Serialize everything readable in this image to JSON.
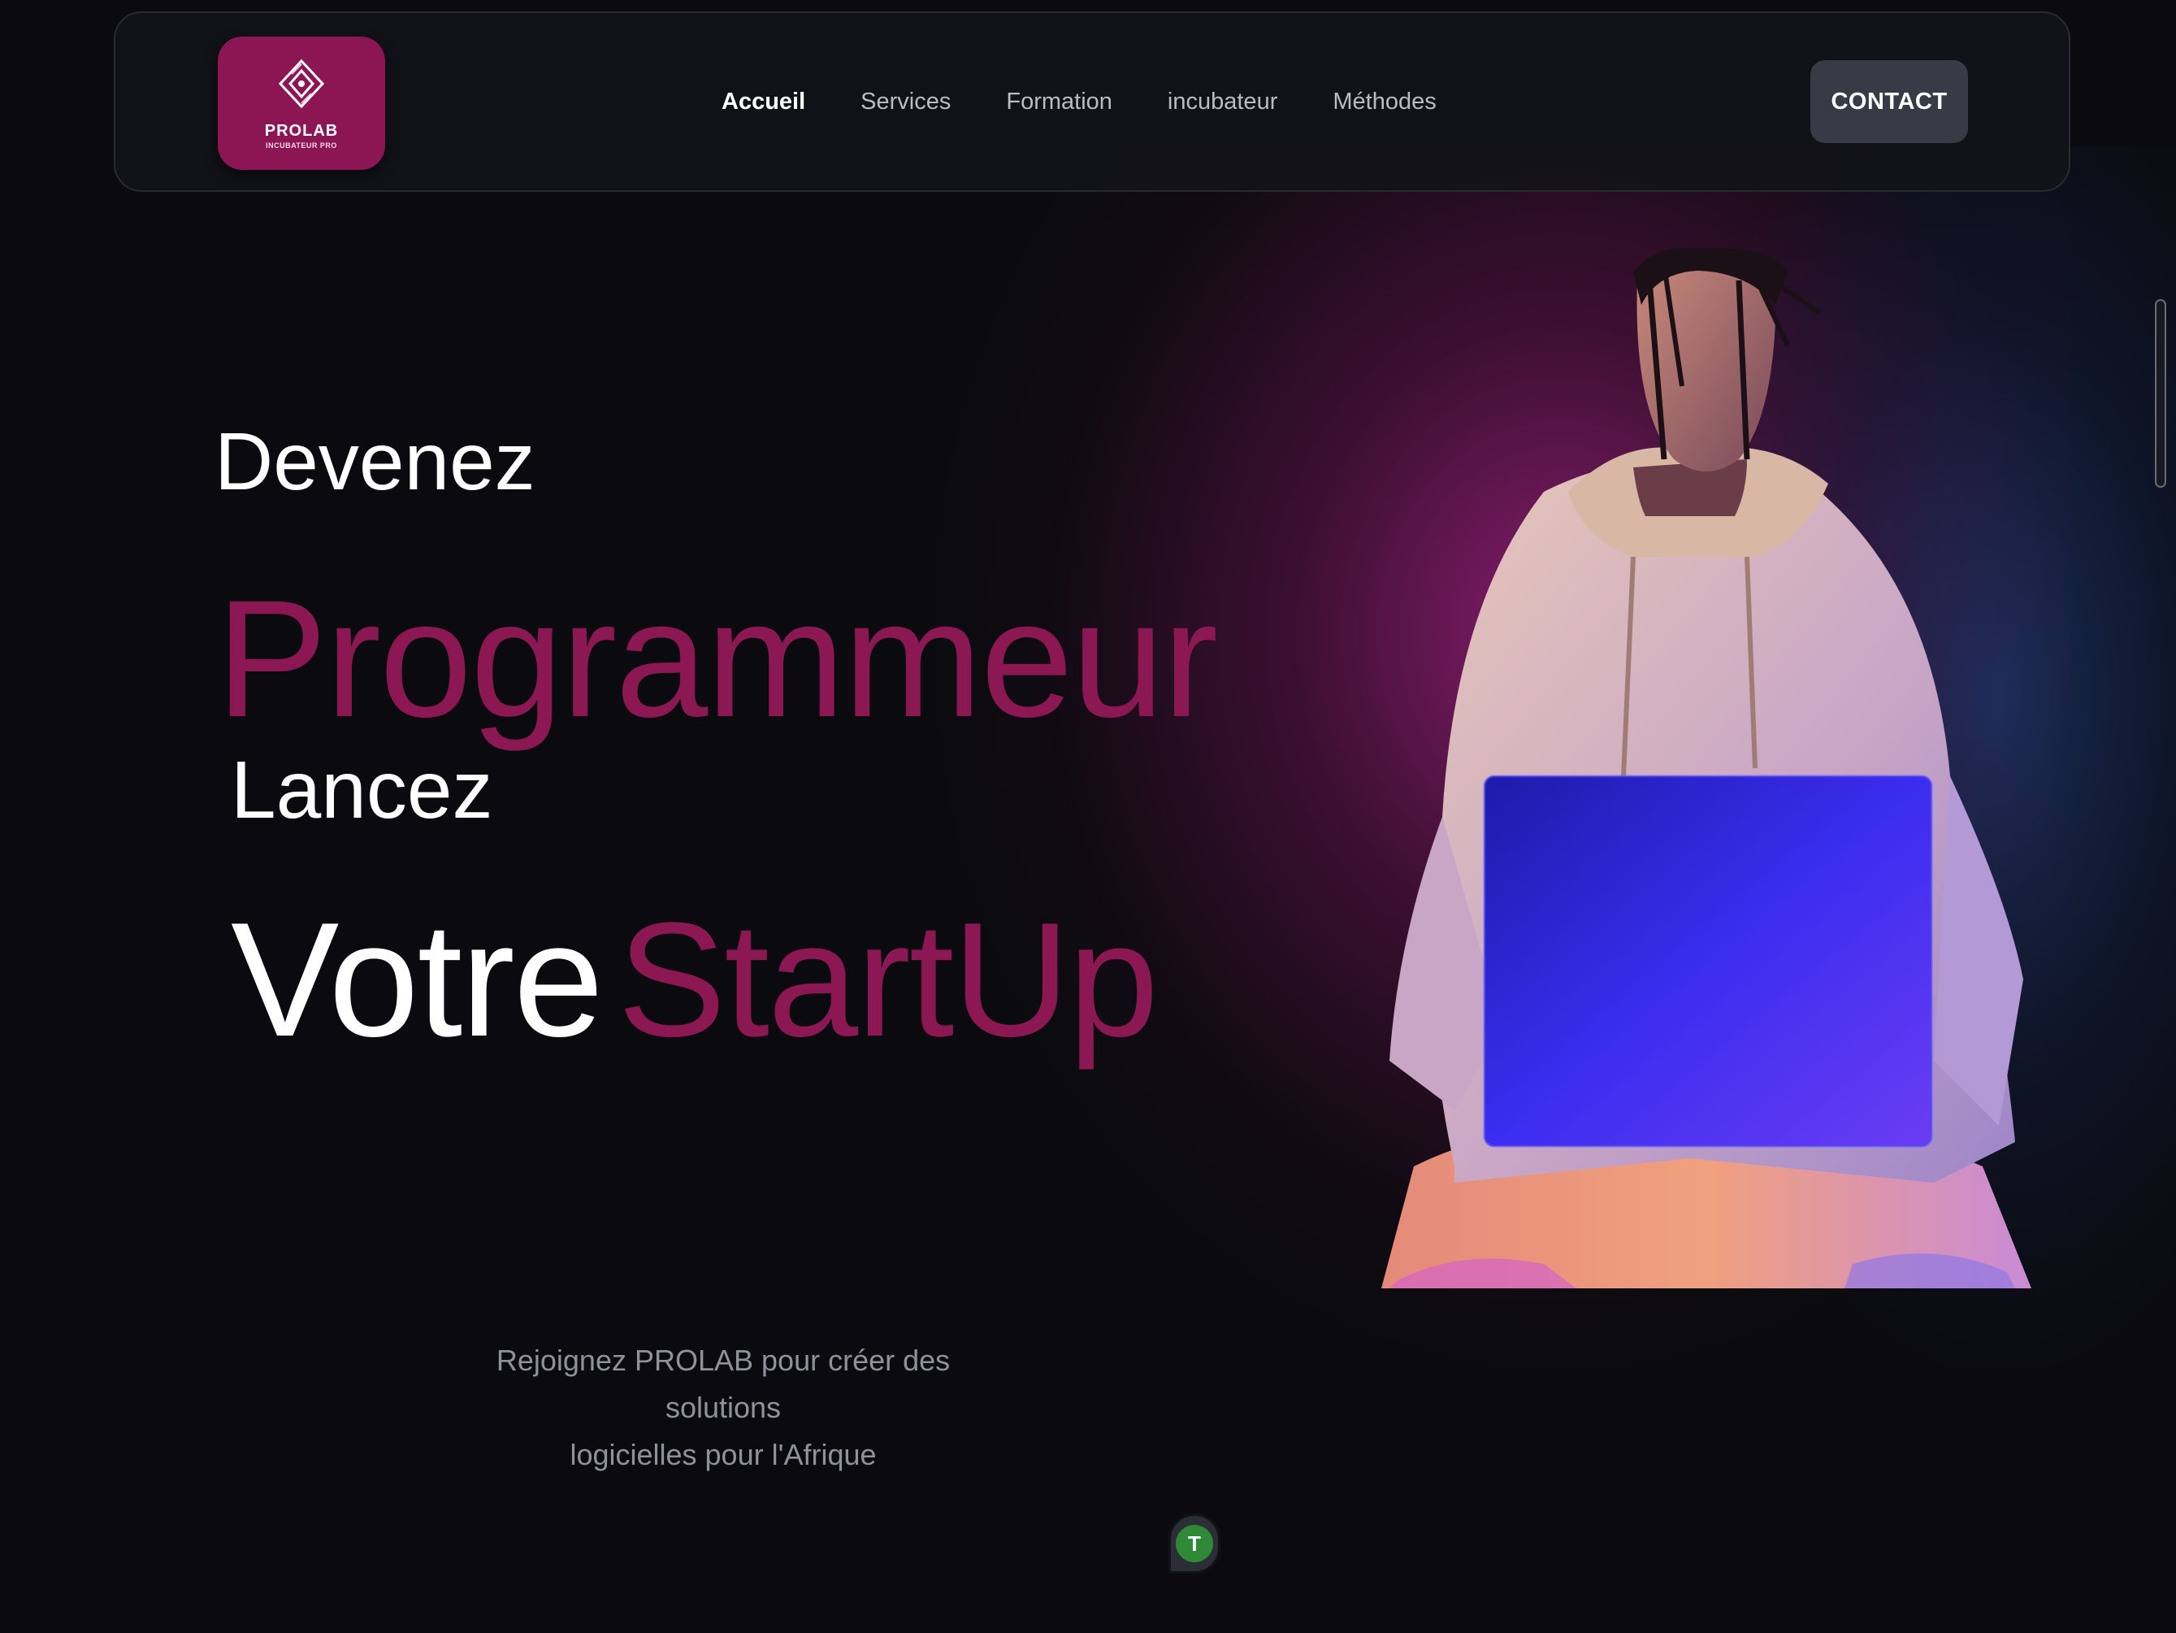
{
  "navbar": {
    "logo": {
      "title": "PROLAB",
      "subtitle": "INCUBATEUR PRO"
    },
    "links": [
      {
        "label": "Accueil",
        "active": true
      },
      {
        "label": "Services",
        "active": false
      },
      {
        "label": "Formation",
        "active": false
      },
      {
        "label": "incubateur",
        "active": false
      },
      {
        "label": "Méthodes",
        "active": false
      }
    ],
    "contact_label": "CONTACT"
  },
  "hero": {
    "line1": "Devenez",
    "line2": "Programmeur",
    "line3": "Lancez",
    "line4a": "Votre",
    "line4b": "StartUp",
    "subtitle_line1": "Rejoignez PROLAB pour créer des solutions",
    "subtitle_line2": "logicielles pour l'Afrique"
  },
  "avatar": {
    "initial": "T"
  },
  "colors": {
    "brand": "#8c1554",
    "accent_text": "#8b1852",
    "background": "#0b0b0f",
    "contact_button": "#383b46",
    "avatar_green": "#2f8a37"
  },
  "icons": {
    "logo": "diamond-logo-icon",
    "avatar": "user-initial-avatar"
  }
}
